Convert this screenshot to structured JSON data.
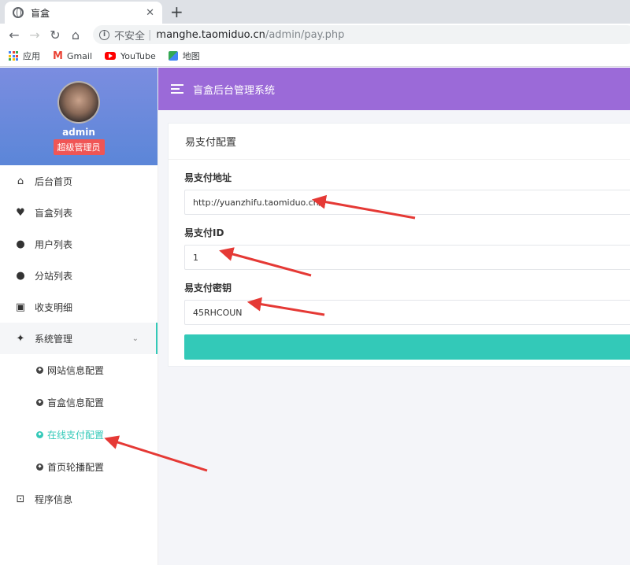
{
  "browser": {
    "tab_title": "盲盒",
    "url_insecure": "不安全",
    "url_host": "manghe.taomiduo.cn",
    "url_path": "/admin/pay.php",
    "bookmarks": [
      "应用",
      "Gmail",
      "YouTube",
      "地图"
    ]
  },
  "sidebar": {
    "username": "admin",
    "role": "超级管理员",
    "items": [
      {
        "label": "后台首页",
        "icon": "home-icon"
      },
      {
        "label": "盲盒列表",
        "icon": "heart-icon"
      },
      {
        "label": "用户列表",
        "icon": "user-icon"
      },
      {
        "label": "分站列表",
        "icon": "user-icon"
      },
      {
        "label": "收支明细",
        "icon": "contact-book-icon"
      },
      {
        "label": "系统管理",
        "icon": "sparkle-icon"
      }
    ],
    "submenu": [
      {
        "label": "网站信息配置"
      },
      {
        "label": "盲盒信息配置"
      },
      {
        "label": "在线支付配置"
      },
      {
        "label": "首页轮播配置"
      }
    ],
    "last_item": {
      "label": "程序信息",
      "icon": "terminal-icon"
    }
  },
  "topbar": {
    "title": "盲盒后台管理系统"
  },
  "form": {
    "header": "易支付配置",
    "fields": [
      {
        "label": "易支付地址",
        "value": "http://yuanzhifu.taomiduo.cn/"
      },
      {
        "label": "易支付ID",
        "value": "1"
      },
      {
        "label": "易支付密钥",
        "value": "45RHCOUN"
      }
    ]
  },
  "colors": {
    "topbar": "#9b6ad8",
    "accent": "#33c9b8",
    "badge": "#f05555",
    "arrow": "#e53935"
  }
}
